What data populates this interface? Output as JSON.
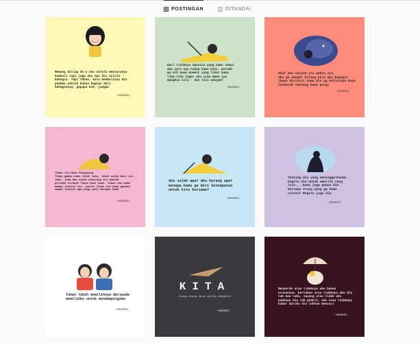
{
  "tabs": {
    "posts": "POSTINGAN",
    "tagged": "DITANDAI"
  },
  "posts": [
    {
      "bg": "#fcfab6",
      "dark": false,
      "quote": "Memang ditiap do'a aku selalu memintanya\nkembali tapi juga aku mau dia selalu\nbahagia. Tapi Tuhan, kalo kembalinya dia\npadaku adalah bukan bagian dari\nbahagianya, gapapa kok, jangan",
      "sig": "—omaaku"
    },
    {
      "bg": "#cde3c9",
      "dark": false,
      "quote": "Dari risihnya manusia yang kamu temui\ndan seru nya hidup kamu kini, pernah\nga sih kamu moment yang lihat kamu\ntiba-tiba inget aku atau mmmm iya\nmungkin kita - dan lalu senyum?",
      "sig": "—omaaku"
    },
    {
      "bg": "#fb8c7c",
      "dark": false,
      "quote": "Maaf aku sejaim itu waktu itu.\nAku ga sempet bilang kalo aku bahagia\n(kamu dicinta) sama dia yg keliatnya kaya\nterburuk tentang kamu pergi",
      "sig": "—omaaku"
    },
    {
      "bg": "#f5b6cf",
      "dark": false,
      "quote": "Tuhan itu Maha Penyayang\nTuhan gamau kamu lebih luka, lebih sedih dari ini. Jadi, luka dan sedih sekarang ini adalah\npilihan terbaik Tuhan buat kamu. Tuhan tau kamu\nmampu lewatin ini, justru Tuhan tau kamu gaakan\nmampu lewatin apa yang jadi harapan kamu",
      "sig": "—omaaku"
    },
    {
      "bg": "#c8e7f6",
      "dark": false,
      "quote": "Aku salah apa? Aku kurang apa?\nKenapa kamu ga beri kesempatan\nuntuk kita bersama?",
      "sig": "—omaaku"
    },
    {
      "bg": "#cfc1e1",
      "dark": false,
      "quote": "Tentang dia yang meninggalkanmu\nbegitu dia untuk memilih yang\nlain... Kamu juga gamau kan\nbersama orang yang ga kamu\ncintai? Begitu juga dia.",
      "sig": "—omaaku"
    },
    {
      "bg": "#ffffff",
      "dark": false,
      "quote": "Tuhan lebih memilihnya daripada\nmemilihku untuk mendampingimu",
      "sig": "—omaaku"
    },
    {
      "bg": "#39393b",
      "dark": true,
      "title": "KITA",
      "quote": "Orang asing yang saling mengenal",
      "sig": "—omaaku"
    },
    {
      "bg": "#38121f",
      "dark": true,
      "quote": "Menyerah atau tidaknya aku bukan\nurusannya. bertahan atau tidaknya aku dia\ntak mau tahu, sayang atau tidak aku\npadanya dia tak peduli, ada atau tidaknya\nkabar dariku dia takkan mencari",
      "sig": "—omaaku"
    }
  ]
}
